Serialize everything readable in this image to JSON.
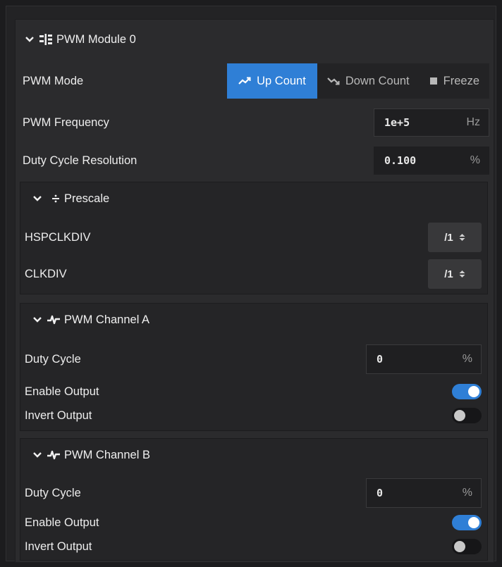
{
  "module": {
    "title": "PWM Module 0",
    "mode": {
      "label": "PWM Mode",
      "options": [
        {
          "label": "Up Count",
          "active": true
        },
        {
          "label": "Down Count",
          "active": false
        },
        {
          "label": "Freeze",
          "active": false
        }
      ]
    },
    "frequency": {
      "label": "PWM Frequency",
      "value": "1e+5",
      "unit": "Hz"
    },
    "resolution": {
      "label": "Duty Cycle Resolution",
      "value": "0.100",
      "unit": "%"
    }
  },
  "prescale": {
    "title": "Prescale",
    "hspclkdiv": {
      "label": "HSPCLKDIV",
      "value": "/1"
    },
    "clkdiv": {
      "label": "CLKDIV",
      "value": "/1"
    }
  },
  "channel_a": {
    "title": "PWM Channel A",
    "duty": {
      "label": "Duty Cycle",
      "value": "0",
      "unit": "%"
    },
    "enable": {
      "label": "Enable Output",
      "on": true
    },
    "invert": {
      "label": "Invert Output",
      "on": false
    }
  },
  "channel_b": {
    "title": "PWM Channel B",
    "duty": {
      "label": "Duty Cycle",
      "value": "0",
      "unit": "%"
    },
    "enable": {
      "label": "Enable Output",
      "on": true
    },
    "invert": {
      "label": "Invert Output",
      "on": false
    }
  },
  "colors": {
    "accent": "#2f7fd6",
    "panel": "#2b2b2d",
    "background": "#1c1c1e"
  },
  "icons": {
    "collapse": "chevron-down-icon",
    "module": "module-icon",
    "prescale": "divide-icon",
    "channel": "pulse-icon",
    "up_count": "trend-up-icon",
    "down_count": "trend-down-icon",
    "freeze": "stop-square-icon",
    "select": "up-down-caret-icon"
  }
}
